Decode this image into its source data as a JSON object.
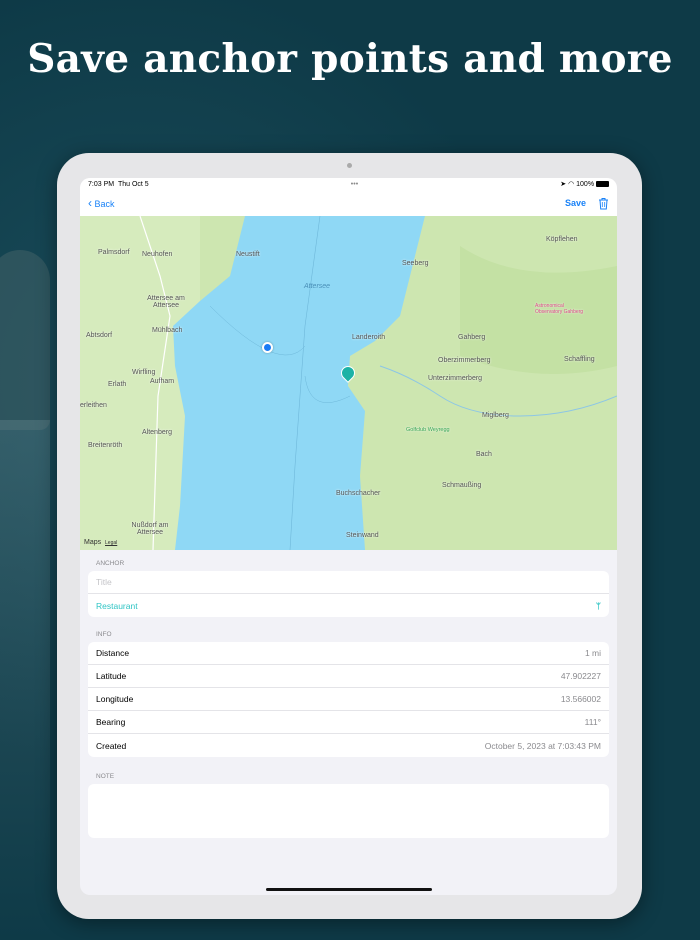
{
  "headline": "Save anchor points and more",
  "status": {
    "time": "7:03 PM",
    "date": "Thu Oct 5",
    "dots": "•••",
    "battery": "100%"
  },
  "nav": {
    "back": "Back",
    "save": "Save"
  },
  "map": {
    "labels": [
      "Palmsdorf",
      "Neuhofen",
      "Neustift",
      "Seeberg",
      "Köpflehen",
      "Attersee",
      "Attersee am Attersee",
      "Mühlbach",
      "Abtsdorf",
      "Landeroith",
      "Gahberg",
      "Astronomical Observatory Gahberg",
      "Oberzimmerberg",
      "Schaffling",
      "Unterzimmerberg",
      "Wirfling",
      "Aufham",
      "Erlath",
      "erleithen",
      "Miglberg",
      "Altenberg",
      "Golfclub Weyregg",
      "Breitenröth",
      "Bach",
      "Schmaußing",
      "Buchschacher",
      "Nußdorf am Attersee",
      "Steinwand"
    ],
    "brand": "Maps",
    "legal": "Legal"
  },
  "anchor": {
    "header": "ANCHOR",
    "title_placeholder": "Title",
    "category": "Restaurant",
    "accent": "#2ec4c4"
  },
  "info": {
    "header": "INFO",
    "rows": [
      {
        "label": "Distance",
        "value": "1 mi"
      },
      {
        "label": "Latitude",
        "value": "47.902227"
      },
      {
        "label": "Longitude",
        "value": "13.566002"
      },
      {
        "label": "Bearing",
        "value": "111°"
      },
      {
        "label": "Created",
        "value": "October 5, 2023 at 7:03:43 PM"
      }
    ]
  },
  "note": {
    "header": "NOTE"
  }
}
